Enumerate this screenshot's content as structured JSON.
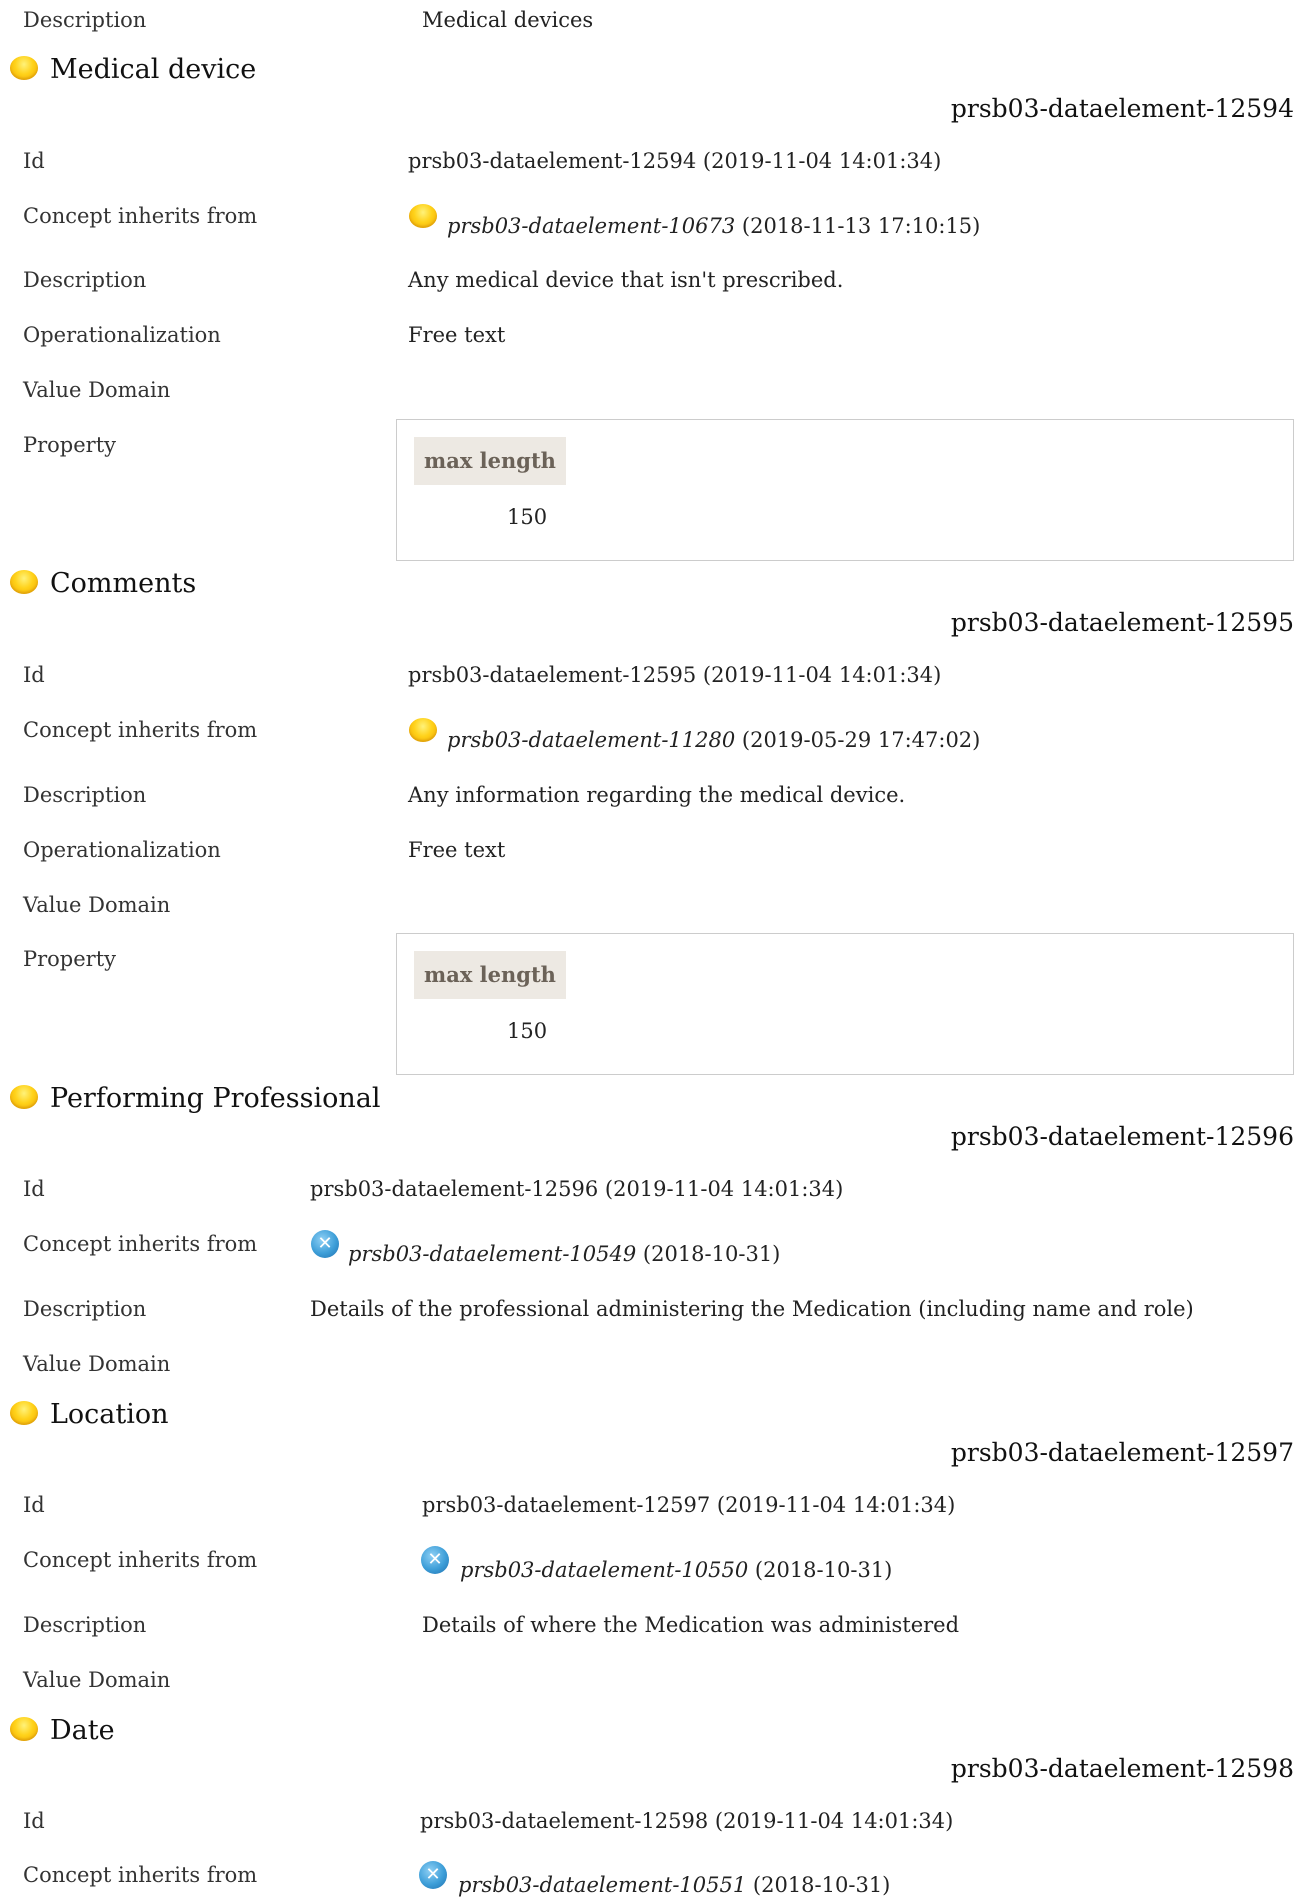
{
  "top": {
    "label": "Description",
    "value": "Medical devices"
  },
  "sections": [
    {
      "title": "Medical device",
      "id_header": "prsb03-dataelement-12594",
      "rows": {
        "id": {
          "label": "Id",
          "value": "prsb03-dataelement-12594 (2019-11-04 14:01:34)"
        },
        "inherits": {
          "label": "Concept inherits from",
          "link": "prsb03-dataelement-10673",
          "date": "(2018-11-13 17:10:15)",
          "icon": "yellow-ball-icon"
        },
        "description": {
          "label": "Description",
          "value": "Any medical device that isn't prescribed."
        },
        "operationalization": {
          "label": "Operationalization",
          "value": "Free text"
        },
        "value_domain": {
          "label": "Value Domain"
        },
        "property": {
          "label": "Property",
          "header": "max length",
          "value": "150"
        }
      }
    },
    {
      "title": "Comments",
      "id_header": "prsb03-dataelement-12595",
      "rows": {
        "id": {
          "label": "Id",
          "value": "prsb03-dataelement-12595 (2019-11-04 14:01:34)"
        },
        "inherits": {
          "label": "Concept inherits from",
          "link": "prsb03-dataelement-11280",
          "date": "(2019-05-29 17:47:02)",
          "icon": "yellow-ball-icon"
        },
        "description": {
          "label": "Description",
          "value": "Any information regarding the medical device."
        },
        "operationalization": {
          "label": "Operationalization",
          "value": "Free text"
        },
        "value_domain": {
          "label": "Value Domain"
        },
        "property": {
          "label": "Property",
          "header": "max length",
          "value": "150"
        }
      }
    },
    {
      "title": "Performing Professional",
      "id_header": "prsb03-dataelement-12596",
      "rows": {
        "id": {
          "label": "Id",
          "value": "prsb03-dataelement-12596 (2019-11-04 14:01:34)"
        },
        "inherits": {
          "label": "Concept inherits from",
          "link": "prsb03-dataelement-10549",
          "date": "(2018-10-31)",
          "icon": "cancel-x-icon"
        },
        "description": {
          "label": "Description",
          "value": "Details of the professional administering the Medication (including name and role)"
        },
        "value_domain": {
          "label": "Value Domain"
        }
      }
    },
    {
      "title": "Location",
      "id_header": "prsb03-dataelement-12597",
      "rows": {
        "id": {
          "label": "Id",
          "value": "prsb03-dataelement-12597 (2019-11-04 14:01:34)"
        },
        "inherits": {
          "label": "Concept inherits from",
          "link": "prsb03-dataelement-10550",
          "date": "(2018-10-31)",
          "icon": "cancel-x-icon"
        },
        "description": {
          "label": "Description",
          "value": "Details of where the Medication was administered"
        },
        "value_domain": {
          "label": "Value Domain"
        }
      }
    },
    {
      "title": "Date",
      "id_header": "prsb03-dataelement-12598",
      "rows": {
        "id": {
          "label": "Id",
          "value": "prsb03-dataelement-12598 (2019-11-04 14:01:34)"
        },
        "inherits": {
          "label": "Concept inherits from",
          "link": "prsb03-dataelement-10551",
          "date": "(2018-10-31)",
          "icon": "cancel-x-icon"
        }
      }
    }
  ]
}
